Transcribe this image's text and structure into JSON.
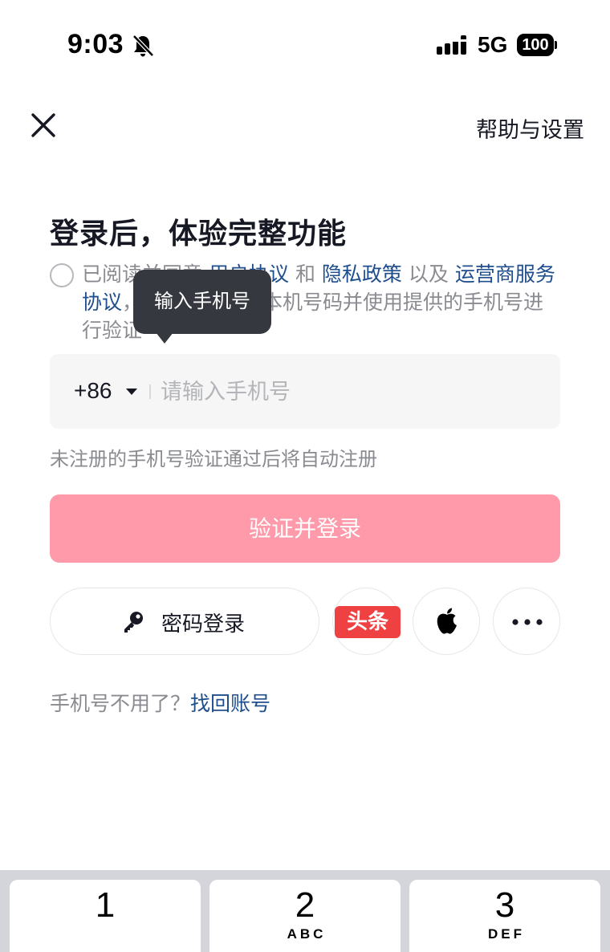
{
  "status_bar": {
    "time": "9:03",
    "network": "5G",
    "battery": "100"
  },
  "header": {
    "close": "close",
    "help_settings": "帮助与设置"
  },
  "title": "登录后，体验完整功能",
  "agreement": {
    "prefix": "已阅读并同意",
    "user_agreement": "用户协议",
    "and": "和",
    "privacy_policy": "隐私政策",
    "and_also": "以及",
    "carrier_service": "运营商服务",
    "carrier_service_2": "协议",
    "suffix": "，授权抖音获取本机号码并使用提供的手机号进行验证"
  },
  "tooltip": "输入手机号",
  "phone": {
    "country_code": "+86",
    "placeholder": "请输入手机号",
    "value": ""
  },
  "hint": "未注册的手机号验证通过后将自动注册",
  "login_button": "验证并登录",
  "alt_login": {
    "password_login": "密码登录",
    "toutiao_logo": "头条",
    "icons": [
      "key-icon",
      "apple-icon",
      "more-icon"
    ]
  },
  "recover": {
    "question": "手机号不用了？",
    "link": "找回账号"
  },
  "keyboard": {
    "keys": [
      {
        "digit": "1",
        "letters": ""
      },
      {
        "digit": "2",
        "letters": "ABC"
      },
      {
        "digit": "3",
        "letters": "DEF"
      }
    ]
  },
  "colors": {
    "brand_pink": "#fe9aaa",
    "link_blue": "#1f4e8c",
    "toutiao_red": "#f04142"
  }
}
